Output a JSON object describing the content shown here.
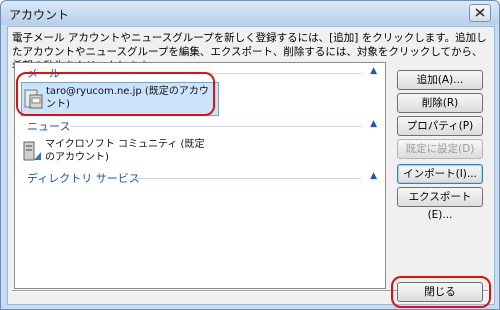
{
  "window": {
    "title": "アカウント"
  },
  "description": "電子メール アカウントやニュースグループを新しく登録するには、[追加] をクリックします。追加したアカウントやニュースグループを編集、エクスポート、削除するには、対象をクリックしてから、希望の動作をクリックします。",
  "groups": [
    {
      "label": "メール",
      "items": [
        {
          "label": "taro@ryucom.ne.jp (既定のアカウント)",
          "selected": true
        }
      ]
    },
    {
      "label": "ニュース",
      "items": [
        {
          "label": "マイクロソフト コミュニティ (既定のアカウント)",
          "selected": false
        }
      ]
    },
    {
      "label": "ディレクトリ サービス",
      "items": []
    }
  ],
  "buttons": {
    "add": "追加(A)...",
    "remove": "削除(R)",
    "properties": "プロパティ(P)",
    "set_default": "既定に設定(D)",
    "import": "インポート(I)...",
    "export": "エクスポート(E)...",
    "close": "閉じる"
  },
  "colors": {
    "accent": "#1d56b8",
    "highlight": "#e01010",
    "selection": "#cbe3fb"
  }
}
